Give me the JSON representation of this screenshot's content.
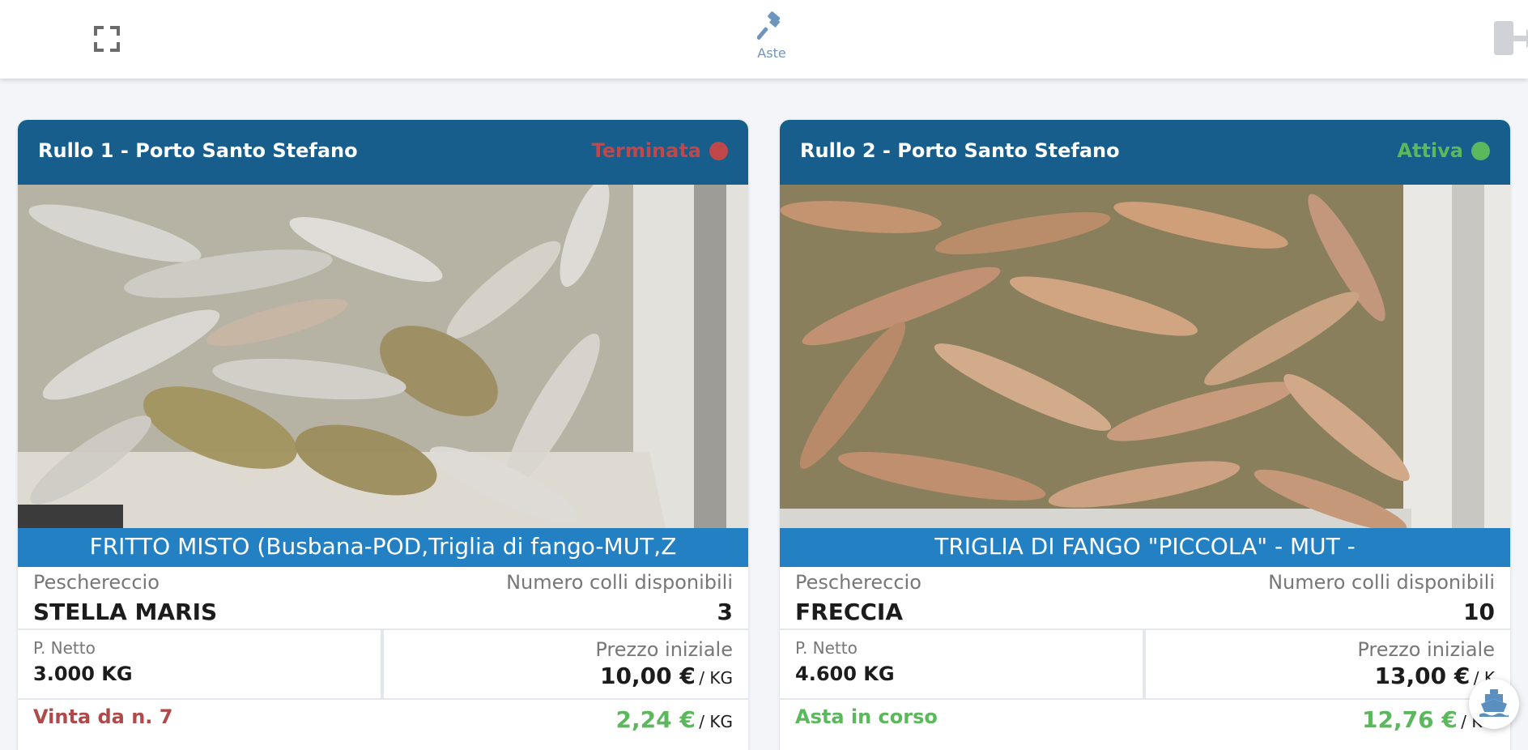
{
  "colors": {
    "header_bg": "#175e8c",
    "product_bar": "#2380c3",
    "status_ended": "#c0474a",
    "status_active": "#5cb85c",
    "nav_accent": "#6f95bf"
  },
  "topbar": {
    "fullscreen_icon": "expand-icon",
    "nav_label": "Aste",
    "nav_icon": "gavel-icon",
    "exit_icon": "logout-icon"
  },
  "cards": [
    {
      "title": "Rullo 1 - Porto Santo Stefano",
      "status": "Terminata",
      "status_color": "#c0474a",
      "product": "FRITTO MISTO (Busbana-POD,Triglia di fango-MUT,Z",
      "boat_label": "Peschereccio",
      "boat_name": "STELLA MARIS",
      "colli_label": "Numero colli disponibili",
      "colli_value": "3",
      "netto_label": "P. Netto",
      "netto_value": "3.000 KG",
      "start_price_label": "Prezzo iniziale",
      "start_price": "10,00 €",
      "start_price_unit": "/ KG",
      "result_label": "Vinta da n. 7",
      "result_color": "#b04a4a",
      "current_price": "2,24 €",
      "current_price_unit": "/ KG"
    },
    {
      "title": "Rullo 2 - Porto Santo Stefano",
      "status": "Attiva",
      "status_color": "#5cb85c",
      "product": "TRIGLIA DI FANGO \"PICCOLA\" - MUT -",
      "boat_label": "Peschereccio",
      "boat_name": "FRECCIA",
      "colli_label": "Numero colli disponibili",
      "colli_value": "10",
      "netto_label": "P. Netto",
      "netto_value": "4.600 KG",
      "start_price_label": "Prezzo iniziale",
      "start_price": "13,00 €",
      "start_price_unit": "/ K",
      "result_label": "Asta in corso",
      "result_color": "#5cb85c",
      "current_price": "12,76 €",
      "current_price_unit": "/ KG"
    }
  ],
  "float_button_icon": "ship-icon"
}
